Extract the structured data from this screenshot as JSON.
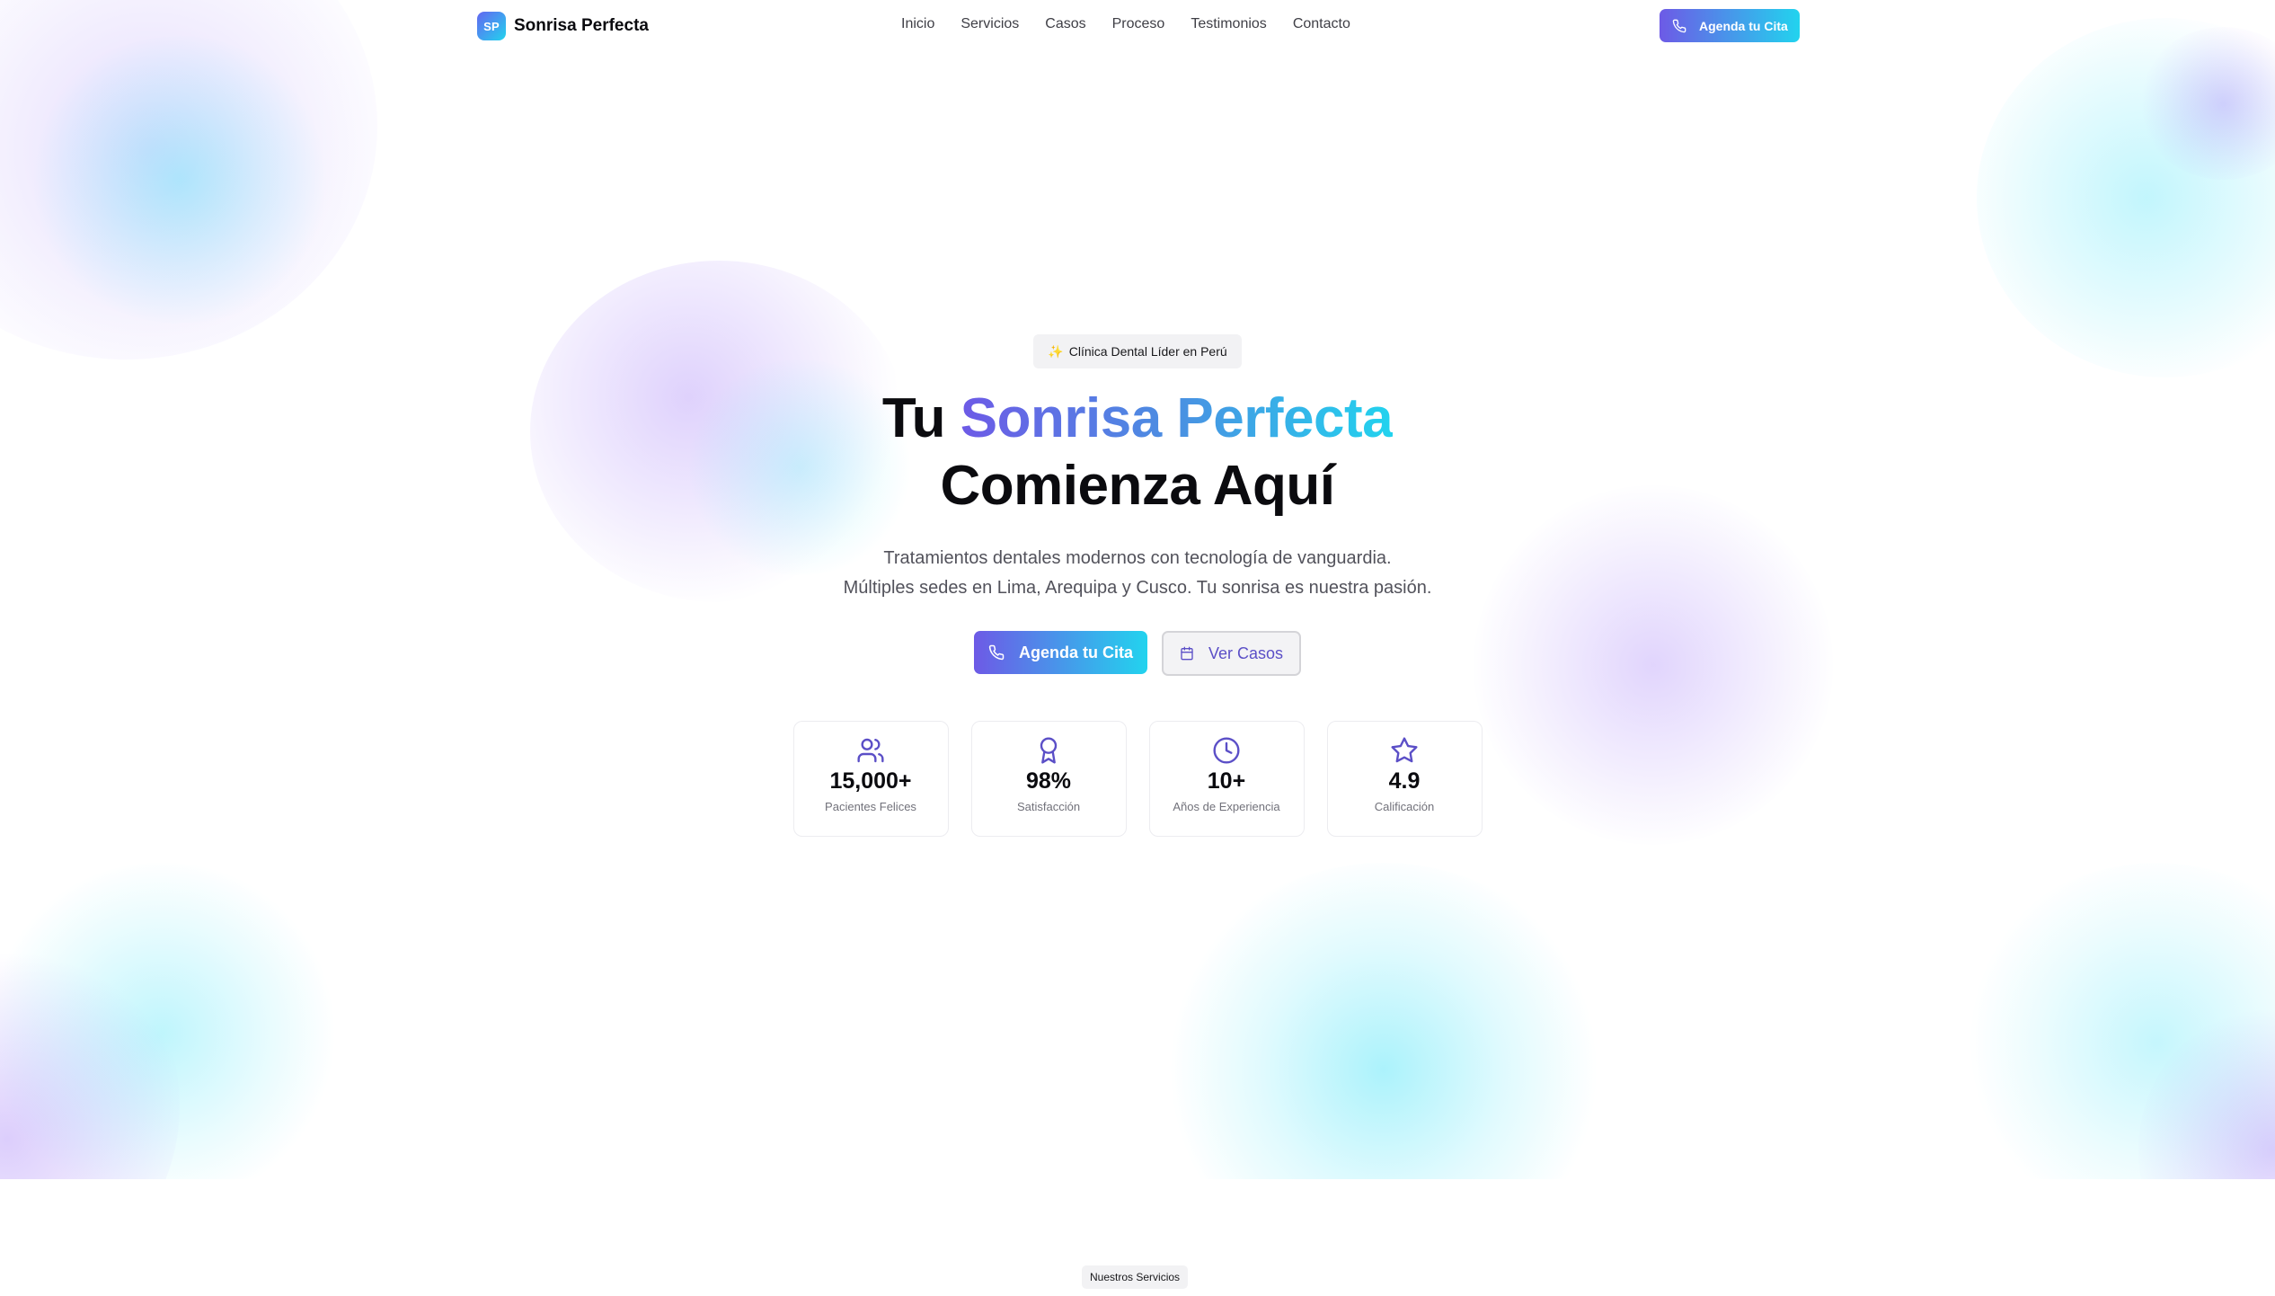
{
  "brand": {
    "logo_text": "SP",
    "name": "Sonrisa Perfecta"
  },
  "nav": {
    "items": [
      {
        "label": "Inicio"
      },
      {
        "label": "Servicios"
      },
      {
        "label": "Casos"
      },
      {
        "label": "Proceso"
      },
      {
        "label": "Testimonios"
      },
      {
        "label": "Contacto"
      }
    ],
    "cta_label": "Agenda tu Cita",
    "cta_icon": "phone-icon"
  },
  "hero": {
    "badge_icon": "✨",
    "badge_text": "Clínica Dental Líder en Perú",
    "title_prefix": "Tu ",
    "title_highlight": "Sonrisa Perfecta",
    "title_line2": "Comienza Aquí",
    "subtitle_line1": "Tratamientos dentales modernos con tecnología de vanguardia.",
    "subtitle_line2": "Múltiples sedes en Lima, Arequipa y Cusco. Tu sonrisa es nuestra pasión.",
    "primary_button": "Agenda tu Cita",
    "primary_icon": "phone-icon",
    "secondary_button": "Ver Casos",
    "secondary_icon": "calendar-icon"
  },
  "stats": [
    {
      "icon": "users-icon",
      "value": "15,000+",
      "label": "Pacientes Felices"
    },
    {
      "icon": "award-icon",
      "value": "98%",
      "label": "Satisfacción"
    },
    {
      "icon": "clock-icon",
      "value": "10+",
      "label": "Años de Experiencia"
    },
    {
      "icon": "star-icon",
      "value": "4.9",
      "label": "Calificación"
    }
  ],
  "services": {
    "badge": "Nuestros Servicios"
  },
  "colors": {
    "accent_violet": "#6d5ae6",
    "accent_cyan": "#22d3ee",
    "icon_color": "#5b4fc7"
  }
}
